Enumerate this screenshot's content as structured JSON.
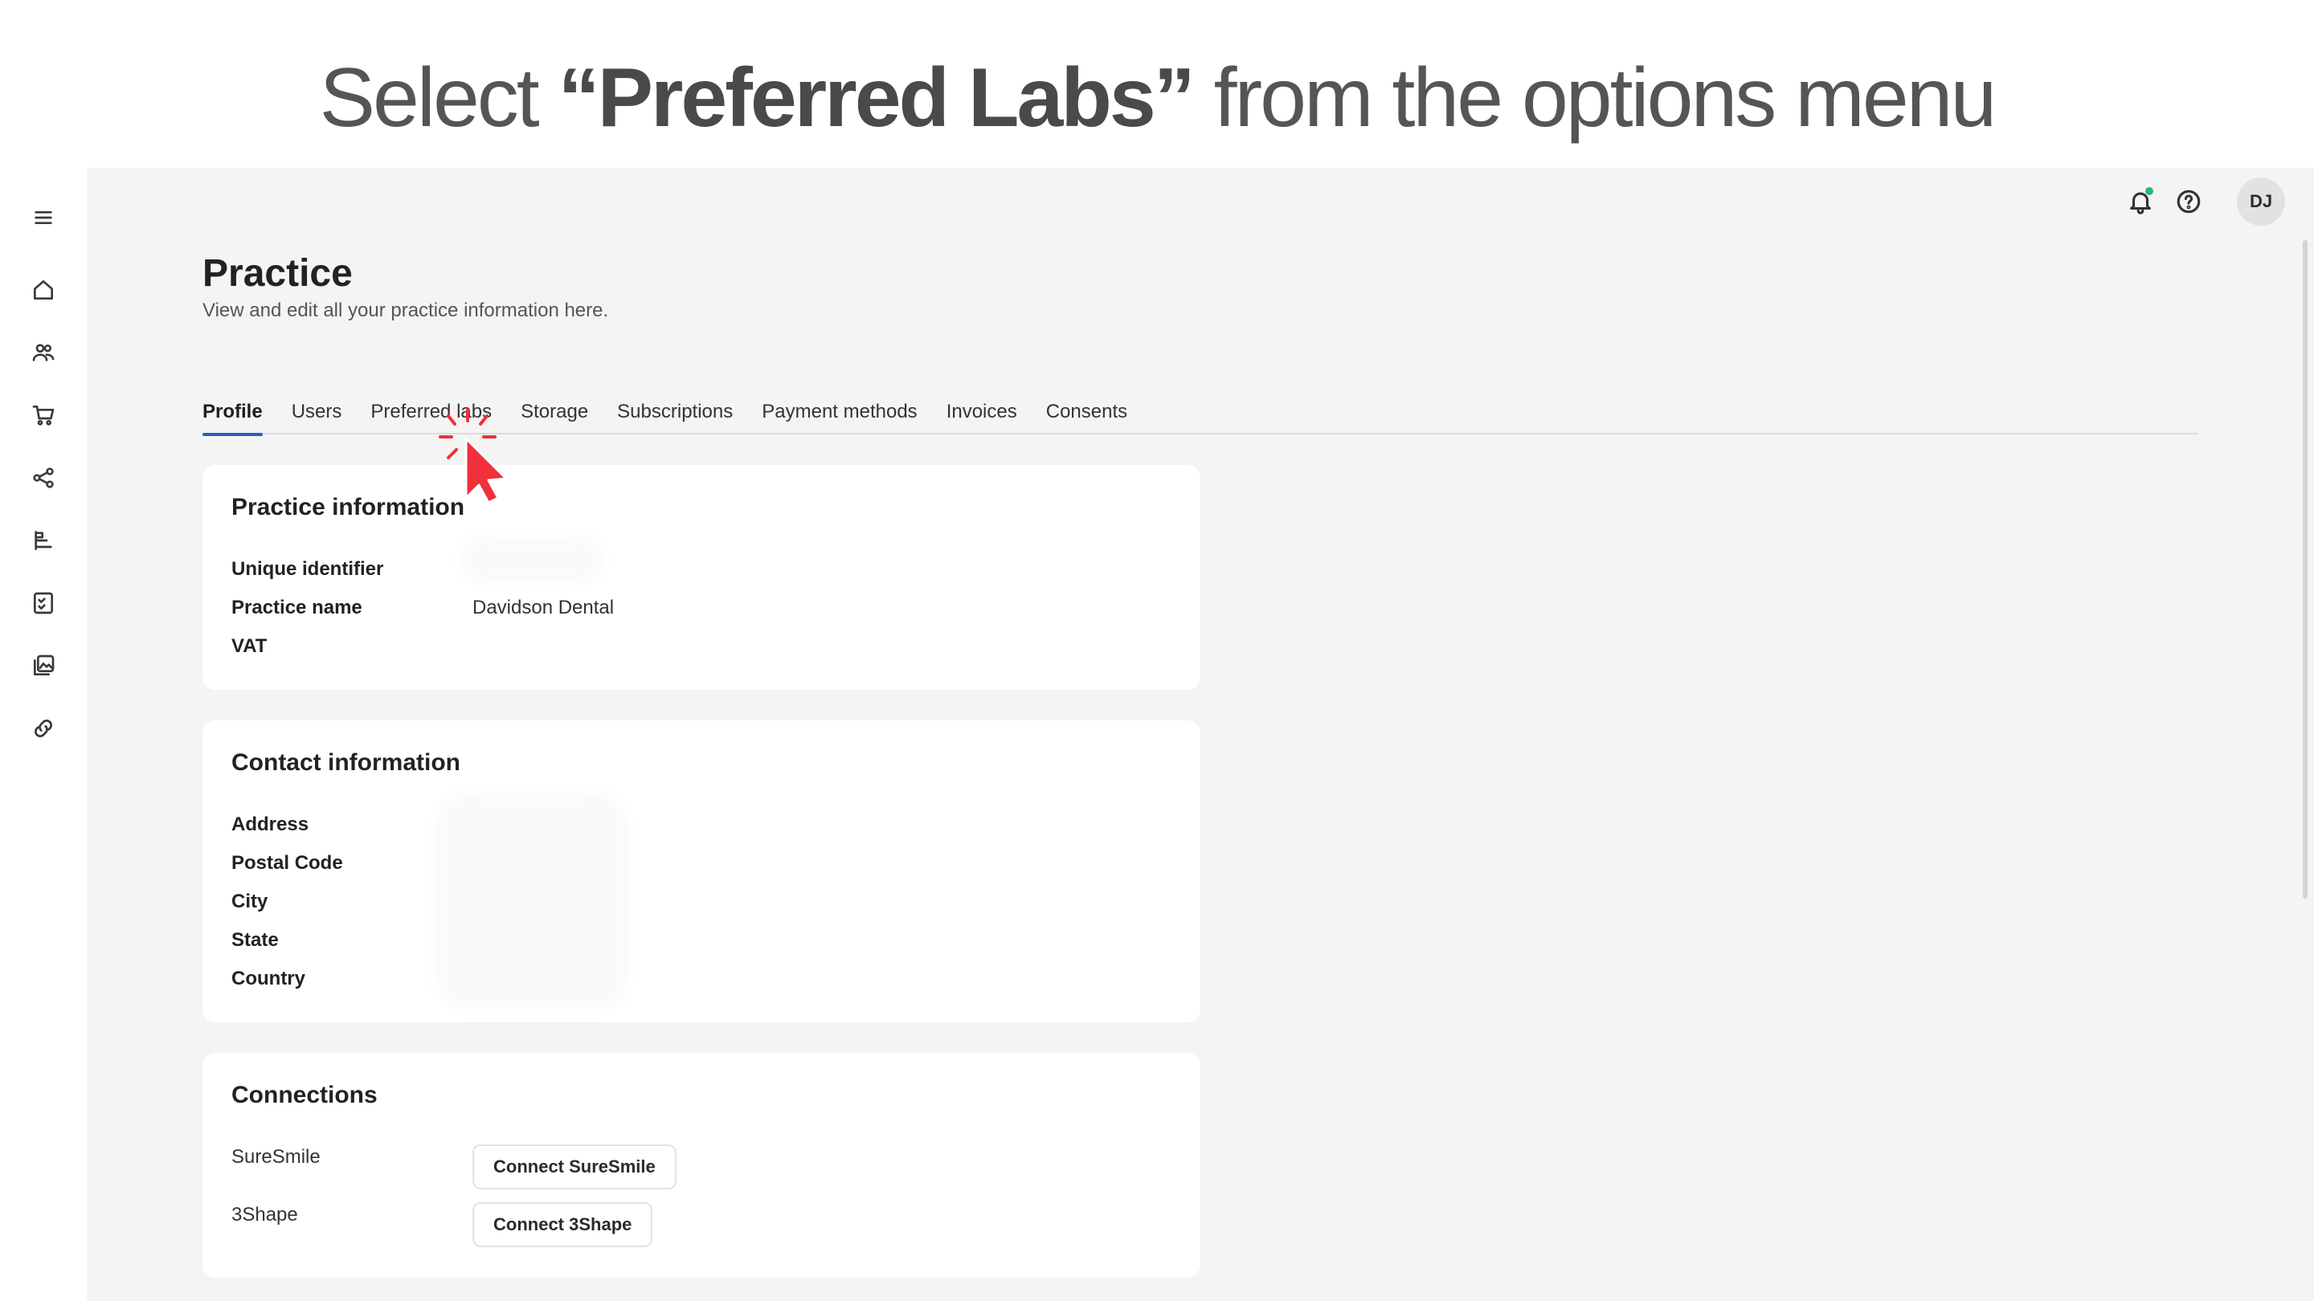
{
  "instruction": {
    "prefix": "Select ",
    "highlight": "“Preferred Labs”",
    "suffix": " from the options menu"
  },
  "header": {
    "avatar_initials": "DJ"
  },
  "page": {
    "title": "Practice",
    "subtitle": "View and edit all your practice information here."
  },
  "tabs": [
    {
      "label": "Profile",
      "active": true
    },
    {
      "label": "Users",
      "active": false
    },
    {
      "label": "Preferred labs",
      "active": false
    },
    {
      "label": "Storage",
      "active": false
    },
    {
      "label": "Subscriptions",
      "active": false
    },
    {
      "label": "Payment methods",
      "active": false
    },
    {
      "label": "Invoices",
      "active": false
    },
    {
      "label": "Consents",
      "active": false
    }
  ],
  "practice_info": {
    "title": "Practice information",
    "fields": [
      {
        "label": "Unique identifier",
        "value": ""
      },
      {
        "label": "Practice name",
        "value": "Davidson Dental"
      },
      {
        "label": "VAT",
        "value": ""
      }
    ]
  },
  "contact_info": {
    "title": "Contact information",
    "fields": [
      {
        "label": "Address"
      },
      {
        "label": "Postal Code"
      },
      {
        "label": "City"
      },
      {
        "label": "State"
      },
      {
        "label": "Country"
      }
    ]
  },
  "connections": {
    "title": "Connections",
    "items": [
      {
        "label": "SureSmile",
        "button": "Connect SureSmile"
      },
      {
        "label": "3Shape",
        "button": "Connect 3Shape"
      }
    ]
  },
  "colors": {
    "accent": "#2a5fbd",
    "cursor": "#f0303a",
    "notification_dot": "#2bb673"
  },
  "icons": {
    "sidebar": [
      "menu-icon",
      "home-icon",
      "users-icon",
      "cart-icon",
      "share-icon",
      "filter-list-icon",
      "checklist-icon",
      "gallery-icon",
      "link-icon"
    ],
    "topbar": [
      "bell-icon",
      "help-icon"
    ]
  }
}
